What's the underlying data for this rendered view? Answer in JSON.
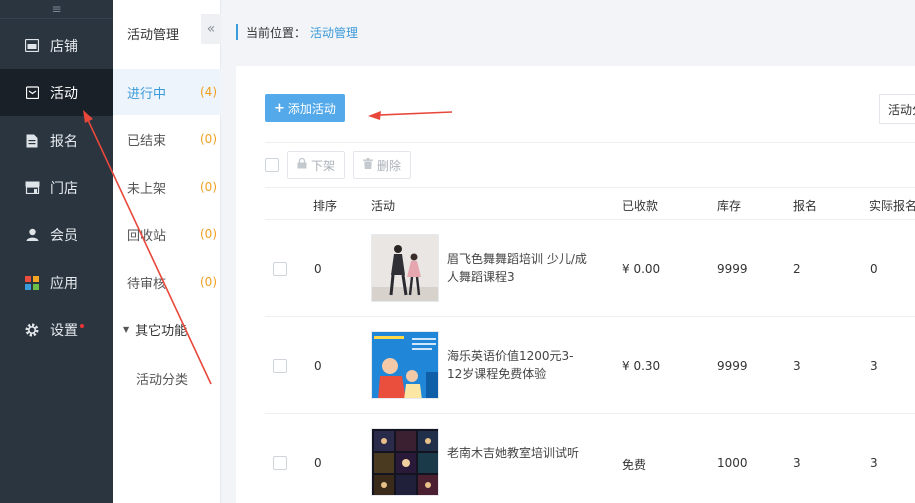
{
  "nav": {
    "toggle_icon": "≡",
    "items": [
      {
        "label": "店铺",
        "icon": "store-icon"
      },
      {
        "label": "活动",
        "icon": "activity-icon"
      },
      {
        "label": "报名",
        "icon": "signup-icon"
      },
      {
        "label": "门店",
        "icon": "shop-icon"
      },
      {
        "label": "会员",
        "icon": "member-icon"
      },
      {
        "label": "应用",
        "icon": "apps-icon"
      },
      {
        "label": "设置",
        "icon": "settings-icon"
      }
    ]
  },
  "subnav": {
    "title": "活动管理",
    "collapse_icon": "«",
    "items": [
      {
        "label": "进行中",
        "count": "(4)"
      },
      {
        "label": "已结束",
        "count": "(0)"
      },
      {
        "label": "未上架",
        "count": "(0)"
      },
      {
        "label": "回收站",
        "count": "(0)"
      },
      {
        "label": "待审核",
        "count": "(0)"
      }
    ],
    "group": {
      "label": "其它功能",
      "child": "活动分类"
    }
  },
  "breadcrumb": {
    "prefix": "当前位置：",
    "current": "活动管理"
  },
  "toolbar": {
    "add_label": "添加活动",
    "filter_label": "活动分",
    "off_shelf_label": "下架",
    "delete_label": "删除"
  },
  "table": {
    "headers": [
      "排序",
      "活动",
      "已收款",
      "库存",
      "报名",
      "实际报名"
    ],
    "rows": [
      {
        "order": "0",
        "title": "眉飞色舞舞蹈培训 少儿/成人舞蹈课程3",
        "received": "¥ 0.00",
        "stock": "9999",
        "signups": "2",
        "actual": "0"
      },
      {
        "order": "0",
        "title": "海乐英语价值1200元3-12岁课程免费体验",
        "received": "¥ 0.30",
        "stock": "9999",
        "signups": "3",
        "actual": "3"
      },
      {
        "order": "0",
        "title": "老南木吉她教室培训试听",
        "received": "免费",
        "stock": "1000",
        "signups": "3",
        "actual": "3"
      }
    ]
  },
  "colors": {
    "accent": "#3b9ad9",
    "nav_bg": "#2b3540",
    "count": "#f0a020",
    "arrow": "#e8483b"
  }
}
